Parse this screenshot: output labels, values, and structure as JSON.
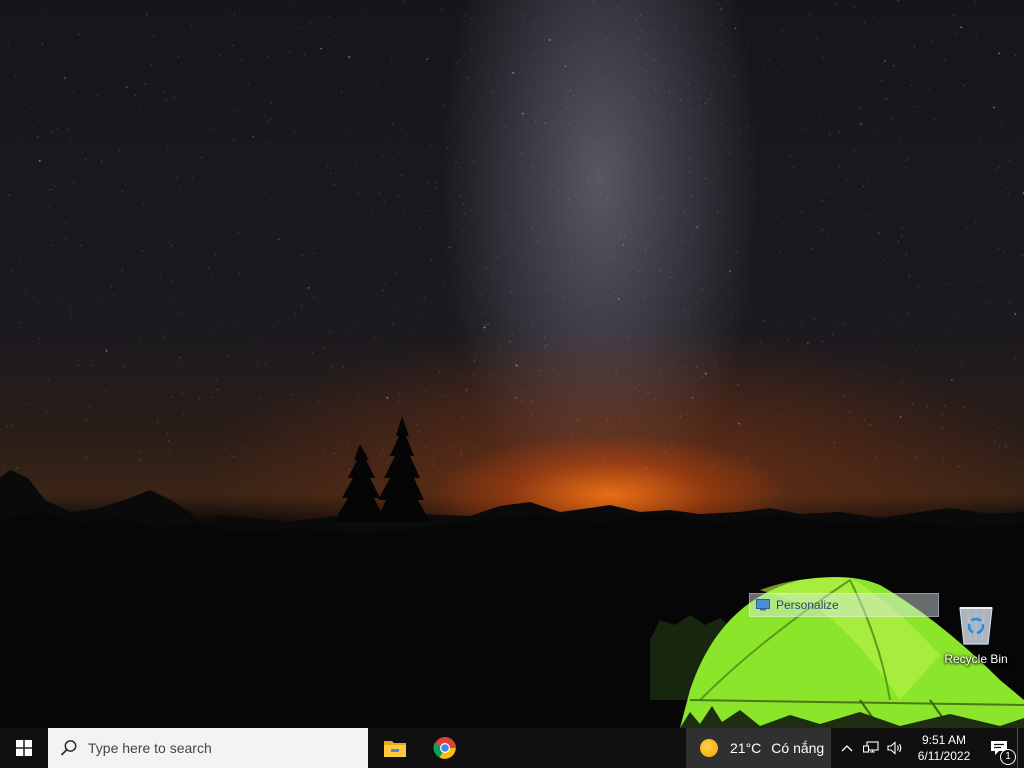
{
  "desktop": {
    "wallpaper": "night-sky-milky-way-camping-tent",
    "icons": [
      {
        "label": "Recycle Bin",
        "icon": "recycle-bin-icon"
      }
    ],
    "tooltip": {
      "label": "Personalize",
      "icon": "personalize-icon"
    }
  },
  "taskbar": {
    "start_icon": "windows-logo-icon",
    "search": {
      "placeholder": "Type here to search",
      "icon": "search-icon"
    },
    "pinned": [
      {
        "name": "File Explorer",
        "icon": "folder-icon"
      },
      {
        "name": "Google Chrome",
        "icon": "chrome-icon"
      }
    ],
    "weather": {
      "temperature": "21°C",
      "condition": "Có nắng",
      "icon": "sun-icon"
    },
    "tray": {
      "icons": [
        "chevron-up-icon",
        "network-icon",
        "volume-icon"
      ],
      "time": "9:51 AM",
      "date": "6/11/2022",
      "notification_count": "1"
    }
  },
  "colors": {
    "taskbar_bg": "#101010",
    "search_bg": "#f3f3f3",
    "weather_bg": "#303030",
    "tent_green": "#8be52a"
  }
}
